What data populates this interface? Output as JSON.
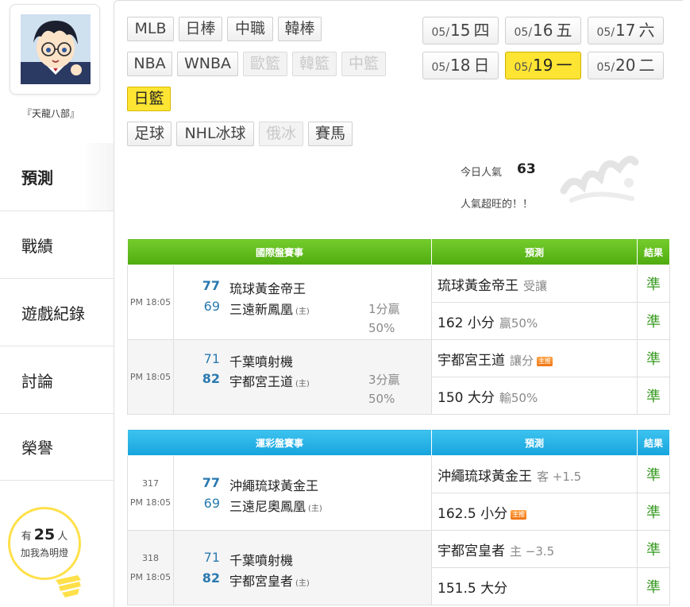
{
  "user": {
    "name": "『天龍八部』"
  },
  "nav": [
    {
      "label": "預測"
    },
    {
      "label": "戰績"
    },
    {
      "label": "遊戲紀錄"
    },
    {
      "label": "討論"
    },
    {
      "label": "榮譽"
    }
  ],
  "fans": {
    "prefix": "有",
    "count": "25",
    "suffix": "人",
    "line2": "加我為明燈"
  },
  "leagues": [
    {
      "label": "MLB"
    },
    {
      "label": "日棒"
    },
    {
      "label": "中職"
    },
    {
      "label": "韓棒"
    },
    {
      "label": "NBA"
    },
    {
      "label": "WNBA"
    },
    {
      "label": "歐籃"
    },
    {
      "label": "韓籃"
    },
    {
      "label": "中籃"
    },
    {
      "label": "日籃"
    },
    {
      "label": "足球"
    },
    {
      "label": "NHL冰球"
    },
    {
      "label": "俄冰"
    },
    {
      "label": "賽馬"
    }
  ],
  "dates": [
    {
      "md": "05/",
      "day": "15",
      "wk": "四"
    },
    {
      "md": "05/",
      "day": "16",
      "wk": "五"
    },
    {
      "md": "05/",
      "day": "17",
      "wk": "六"
    },
    {
      "md": "05/",
      "day": "18",
      "wk": "日"
    },
    {
      "md": "05/",
      "day": "19",
      "wk": "一"
    },
    {
      "md": "05/",
      "day": "20",
      "wk": "二"
    }
  ],
  "popularity": {
    "label": "今日人氣",
    "value": "63",
    "note": "人氣超旺的！！"
  },
  "intl": {
    "header": {
      "title": "國際盤賽事",
      "pred": "預測",
      "result": "結果"
    },
    "games": [
      {
        "time": "PM 18:05",
        "away": {
          "score": "77",
          "name": "琉球黃金帝王"
        },
        "home": {
          "score": "69",
          "name": "三遠新鳳凰",
          "mark": "(主)"
        },
        "spread1": "1分贏",
        "spread2": "50%",
        "preds": [
          {
            "main": "琉球黃金帝王",
            "sub": "受讓",
            "result": "準"
          },
          {
            "main": "162 小分",
            "sub": "贏50%",
            "result": "準"
          }
        ]
      },
      {
        "time": "PM 18:05",
        "away": {
          "score": "71",
          "name": "千葉噴射機"
        },
        "home": {
          "score": "82",
          "name": "宇都宮王道",
          "mark": "(主)"
        },
        "spread1": "3分贏",
        "spread2": "50%",
        "preds": [
          {
            "main": "宇都宮王道",
            "sub": "讓分",
            "tag": "主推",
            "result": "準"
          },
          {
            "main": "150 大分",
            "sub": "輸50%",
            "result": "準"
          }
        ]
      }
    ]
  },
  "lottery": {
    "header": {
      "title": "運彩盤賽事",
      "pred": "預測",
      "result": "結果"
    },
    "games": [
      {
        "num": "317",
        "time": "PM 18:05",
        "away": {
          "score": "77",
          "name": "沖繩琉球黃金王"
        },
        "home": {
          "score": "69",
          "name": "三遠尼奧鳳凰",
          "mark": "(主)"
        },
        "preds": [
          {
            "main": "沖繩琉球黃金王",
            "sub": "客 +1.5",
            "result": "準"
          },
          {
            "main": "162.5 小分",
            "tag": "主推",
            "result": "準"
          }
        ]
      },
      {
        "num": "318",
        "time": "PM 18:05",
        "away": {
          "score": "71",
          "name": "千葉噴射機"
        },
        "home": {
          "score": "82",
          "name": "宇都宮皇者",
          "mark": "(主)"
        },
        "preds": [
          {
            "main": "宇都宮皇者",
            "sub": "主 −3.5",
            "result": "準"
          },
          {
            "main": "151.5 大分",
            "result": "準"
          }
        ]
      }
    ]
  },
  "colors": {
    "intl_header": "#5cb81a",
    "lottery_header": "#22aee6",
    "selected": "#ffe533",
    "score": "#2a7ab0",
    "hit": "#3a9b23"
  }
}
